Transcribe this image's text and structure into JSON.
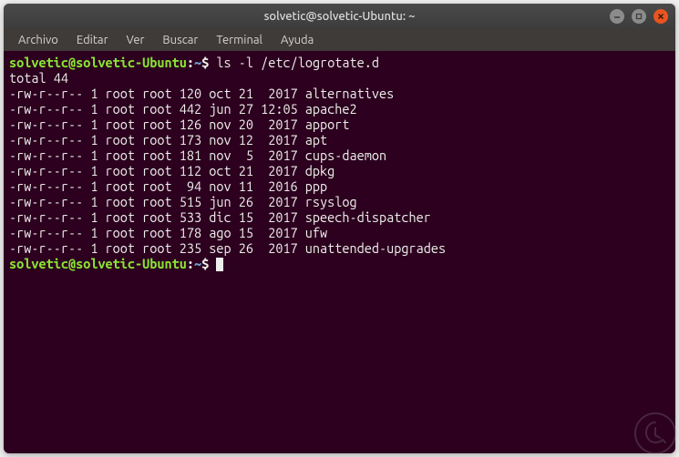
{
  "title_bar": {
    "title": "solvetic@solvetic-Ubuntu: ~"
  },
  "menu": {
    "items": [
      "Archivo",
      "Editar",
      "Ver",
      "Buscar",
      "Terminal",
      "Ayuda"
    ]
  },
  "prompt": {
    "user_host": "solvetic@solvetic-Ubuntu",
    "colon": ":",
    "path": "~",
    "dollar": "$"
  },
  "command1": "ls -l /etc/logrotate.d",
  "total_line": "total 44",
  "listing": [
    {
      "perms": "-rw-r--r--",
      "links": "1",
      "owner": "root",
      "group": "root",
      "size": "120",
      "mon": "oct",
      "day": "21",
      "time": " 2017",
      "name": "alternatives"
    },
    {
      "perms": "-rw-r--r--",
      "links": "1",
      "owner": "root",
      "group": "root",
      "size": "442",
      "mon": "jun",
      "day": "27",
      "time": "12:05",
      "name": "apache2"
    },
    {
      "perms": "-rw-r--r--",
      "links": "1",
      "owner": "root",
      "group": "root",
      "size": "126",
      "mon": "nov",
      "day": "20",
      "time": " 2017",
      "name": "apport"
    },
    {
      "perms": "-rw-r--r--",
      "links": "1",
      "owner": "root",
      "group": "root",
      "size": "173",
      "mon": "nov",
      "day": "12",
      "time": " 2017",
      "name": "apt"
    },
    {
      "perms": "-rw-r--r--",
      "links": "1",
      "owner": "root",
      "group": "root",
      "size": "181",
      "mon": "nov",
      "day": " 5",
      "time": " 2017",
      "name": "cups-daemon"
    },
    {
      "perms": "-rw-r--r--",
      "links": "1",
      "owner": "root",
      "group": "root",
      "size": "112",
      "mon": "oct",
      "day": "21",
      "time": " 2017",
      "name": "dpkg"
    },
    {
      "perms": "-rw-r--r--",
      "links": "1",
      "owner": "root",
      "group": "root",
      "size": " 94",
      "mon": "nov",
      "day": "11",
      "time": " 2016",
      "name": "ppp"
    },
    {
      "perms": "-rw-r--r--",
      "links": "1",
      "owner": "root",
      "group": "root",
      "size": "515",
      "mon": "jun",
      "day": "26",
      "time": " 2017",
      "name": "rsyslog"
    },
    {
      "perms": "-rw-r--r--",
      "links": "1",
      "owner": "root",
      "group": "root",
      "size": "533",
      "mon": "dic",
      "day": "15",
      "time": " 2017",
      "name": "speech-dispatcher"
    },
    {
      "perms": "-rw-r--r--",
      "links": "1",
      "owner": "root",
      "group": "root",
      "size": "178",
      "mon": "ago",
      "day": "15",
      "time": " 2017",
      "name": "ufw"
    },
    {
      "perms": "-rw-r--r--",
      "links": "1",
      "owner": "root",
      "group": "root",
      "size": "235",
      "mon": "sep",
      "day": "26",
      "time": " 2017",
      "name": "unattended-upgrades"
    }
  ]
}
